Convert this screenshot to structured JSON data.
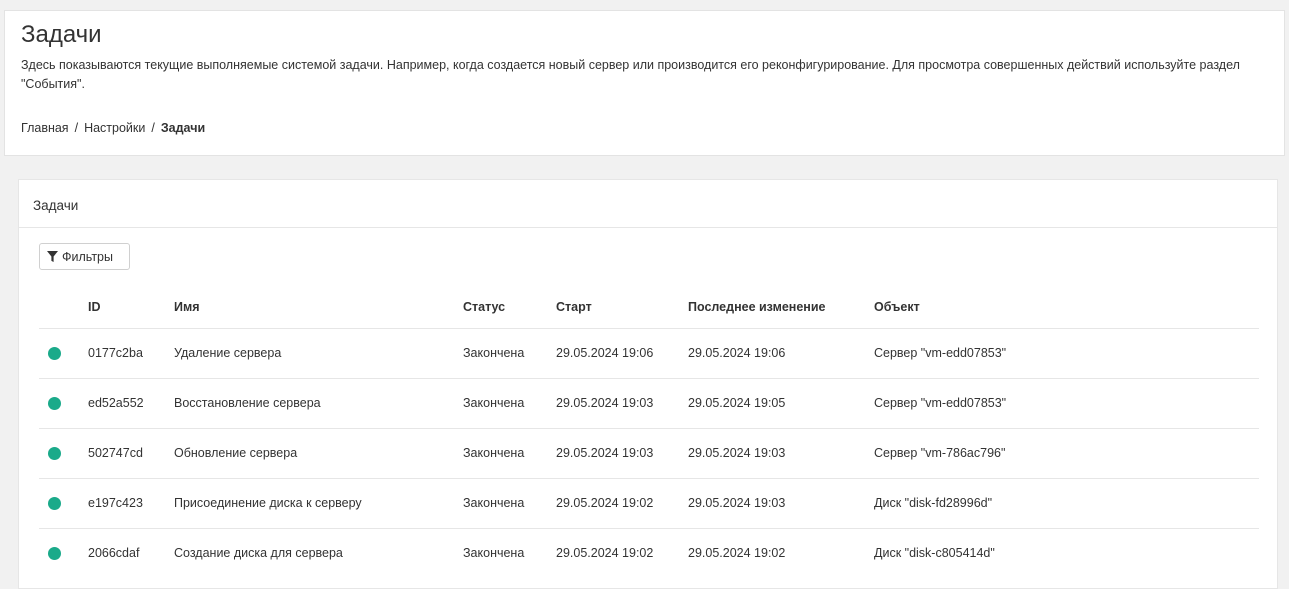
{
  "page": {
    "title": "Задачи",
    "description": "Здесь показываются текущие выполняемые системой задачи. Например, когда создается новый сервер или производится его реконфигурирование. Для просмотра совершенных действий используйте раздел \"События\".",
    "breadcrumb": [
      "Главная",
      "Настройки",
      "Задачи"
    ]
  },
  "card": {
    "title": "Задачи",
    "filter_label": "Фильтры",
    "filter_icon": "filter-funnel-icon"
  },
  "table": {
    "columns": {
      "id": "ID",
      "name": "Имя",
      "status": "Статус",
      "start": "Старт",
      "changed": "Последнее изменение",
      "object": "Объект"
    },
    "rows": [
      {
        "status_color": "#1aaa8a",
        "id": "0177c2ba",
        "name": "Удаление сервера",
        "status": "Закончена",
        "start": "29.05.2024 19:06",
        "changed": "29.05.2024 19:06",
        "object": "Сервер \"vm-edd07853\""
      },
      {
        "status_color": "#1aaa8a",
        "id": "ed52a552",
        "name": "Восстановление сервера",
        "status": "Закончена",
        "start": "29.05.2024 19:03",
        "changed": "29.05.2024 19:05",
        "object": "Сервер \"vm-edd07853\""
      },
      {
        "status_color": "#1aaa8a",
        "id": "502747cd",
        "name": "Обновление сервера",
        "status": "Закончена",
        "start": "29.05.2024 19:03",
        "changed": "29.05.2024 19:03",
        "object": "Сервер \"vm-786ac796\""
      },
      {
        "status_color": "#1aaa8a",
        "id": "e197c423",
        "name": "Присоединение диска к серверу",
        "status": "Закончена",
        "start": "29.05.2024 19:02",
        "changed": "29.05.2024 19:03",
        "object": "Диск \"disk-fd28996d\""
      },
      {
        "status_color": "#1aaa8a",
        "id": "2066cdaf",
        "name": "Создание диска для сервера",
        "status": "Закончена",
        "start": "29.05.2024 19:02",
        "changed": "29.05.2024 19:02",
        "object": "Диск \"disk-c805414d\""
      }
    ]
  }
}
